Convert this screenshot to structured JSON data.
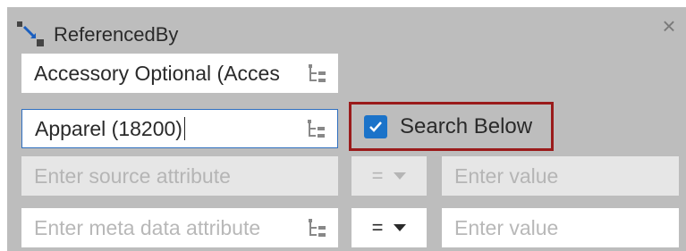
{
  "panel": {
    "title": "ReferencedBy",
    "close_icon": "close-icon",
    "reference_icon": "referenced-by-icon"
  },
  "fields": {
    "reference_type_value": "Accessory Optional (Acces",
    "target_value": "Apparel (18200)",
    "source_attribute_placeholder": "Enter source attribute",
    "value_placeholder_1": "Enter value",
    "meta_attribute_placeholder": "Enter meta data attribute",
    "value_placeholder_2": "Enter value"
  },
  "operators": {
    "op1": "=",
    "op2": "="
  },
  "search_below": {
    "label": "Search Below",
    "checked": true,
    "accent": "#1b73c9",
    "highlight": "#9a1b1b"
  }
}
